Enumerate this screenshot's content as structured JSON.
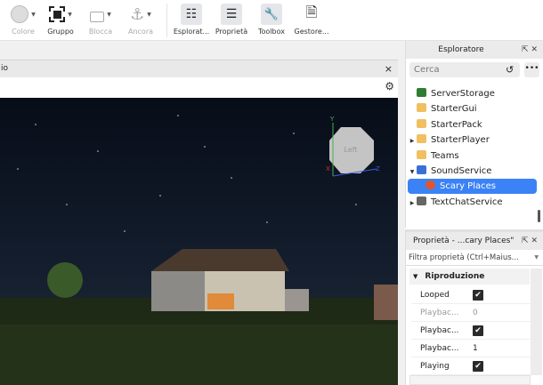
{
  "toolbar": {
    "items": [
      {
        "label": "Colore",
        "icon": "color-circle-icon",
        "disabled": true
      },
      {
        "label": "Gruppo",
        "icon": "group-icon"
      },
      {
        "label": "Blocca",
        "icon": "lock-icon",
        "disabled": true
      },
      {
        "label": "Ancora",
        "icon": "anchor-icon",
        "disabled": true
      },
      {
        "label": "Esplorat...",
        "icon": "explorer-icon"
      },
      {
        "label": "Proprietà",
        "icon": "properties-icon"
      },
      {
        "label": "Toolbox",
        "icon": "toolbox-icon"
      },
      {
        "label": "Gestore...",
        "icon": "asset-manager-icon"
      }
    ]
  },
  "viewport": {
    "tab_label": "io",
    "close": "×",
    "gizmo_label": "Left",
    "axes": {
      "y": "Y",
      "x": "X",
      "z": "Z"
    }
  },
  "explorer": {
    "title": "Esploratore",
    "search_placeholder": "Cerca",
    "items": [
      {
        "label": "ServerStorage",
        "color": "#2e7d32"
      },
      {
        "label": "StarterGui",
        "color": "#f0c060"
      },
      {
        "label": "StarterPack",
        "color": "#f0c060"
      },
      {
        "label": "StarterPlayer",
        "color": "#f0c060",
        "expandable": true
      },
      {
        "label": "Teams",
        "color": "#f0c060"
      },
      {
        "label": "SoundService",
        "color": "#3a6fd8",
        "expanded": true
      },
      {
        "label": "Scary Places",
        "color": "#e2552b",
        "selected": true
      },
      {
        "label": "TextChatService",
        "color": "#666",
        "expandable": true
      }
    ]
  },
  "properties": {
    "title": "Proprietà - ...cary Places\"",
    "filter_placeholder": "Filtra proprietà (Ctrl+Maius...",
    "section": "Riproduzione",
    "rows": [
      {
        "name": "Looped",
        "value": "✔",
        "checkbox": true
      },
      {
        "name": "Playbac...",
        "value": "0",
        "dim": true
      },
      {
        "name": "Playbac...",
        "value": "✔",
        "checkbox": true
      },
      {
        "name": "Playbac...",
        "value": "1"
      },
      {
        "name": "Playing",
        "value": "✔",
        "checkbox": true
      }
    ]
  }
}
